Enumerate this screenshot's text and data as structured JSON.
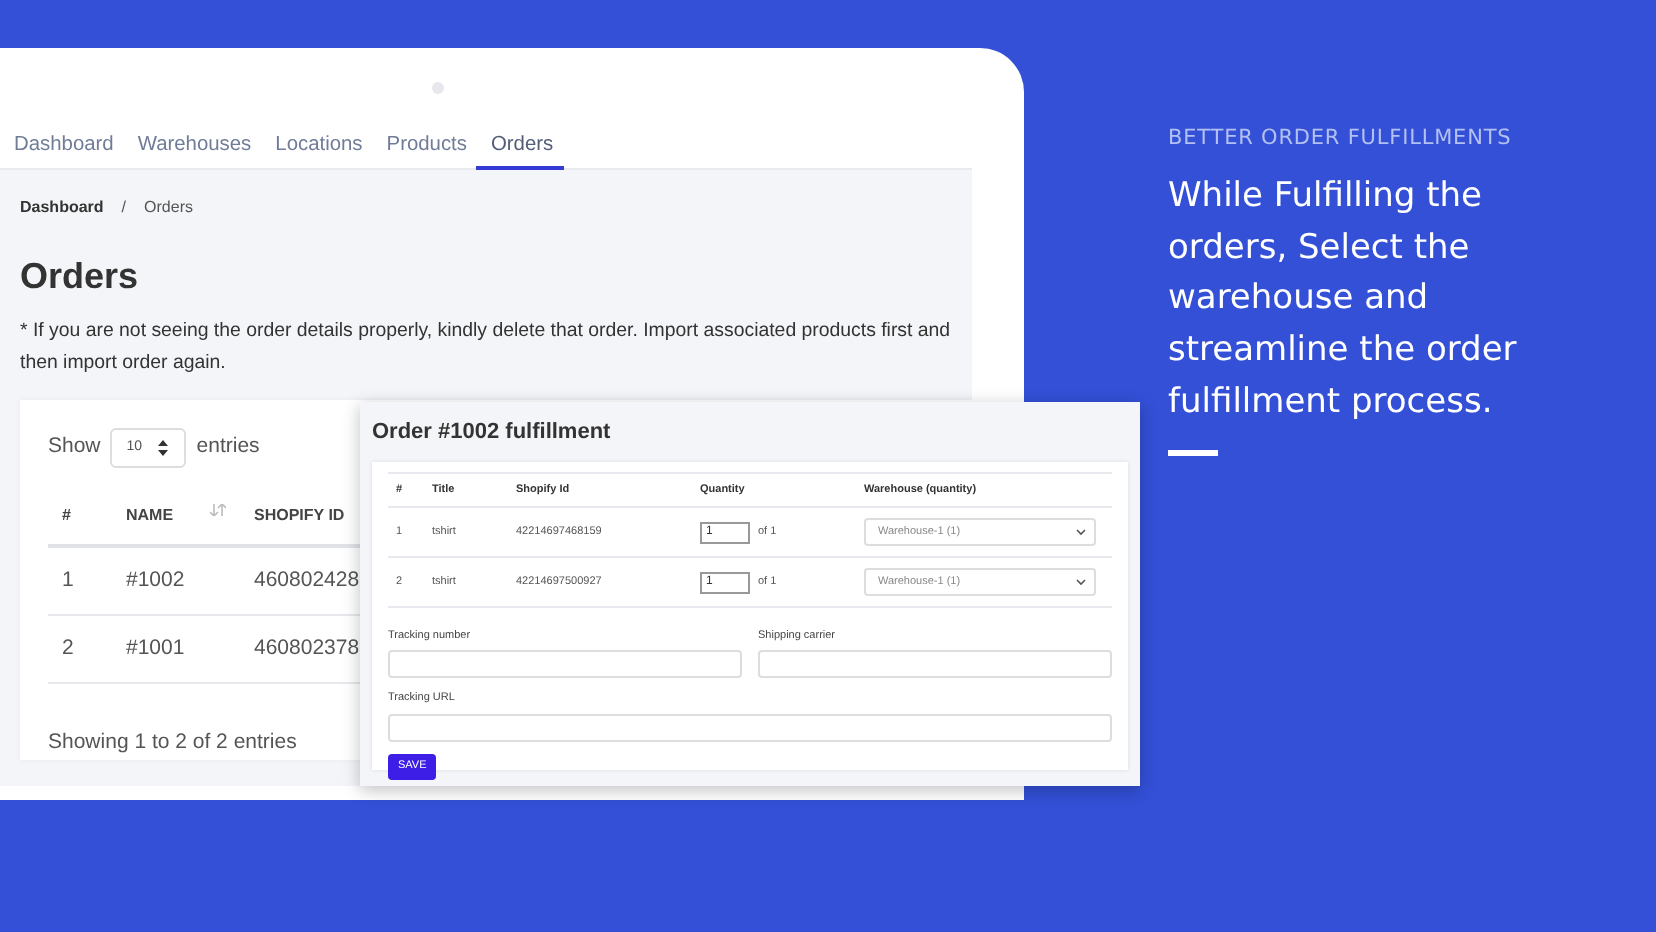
{
  "app": {
    "nav_tabs": [
      {
        "label": "Dashboard",
        "selected": false
      },
      {
        "label": "Warehouses",
        "selected": false
      },
      {
        "label": "Locations",
        "selected": false
      },
      {
        "label": "Products",
        "selected": false
      },
      {
        "label": "Orders",
        "selected": true
      }
    ],
    "breadcrumb": [
      "Dashboard",
      "/",
      "Orders"
    ],
    "title": "Orders",
    "note": "* If you are not seeing the order details properly, kindly delete that order. Import associated products first and then import order again.",
    "length_menu": {
      "label_before": "Show",
      "value": "10",
      "label_after": "entries"
    },
    "table": {
      "columns": [
        "#",
        "NAME",
        "SHOPIFY ID"
      ],
      "rows": [
        [
          "1",
          "#1002",
          "460802428"
        ],
        [
          "2",
          "#1001",
          "460802378"
        ]
      ]
    },
    "info": "Showing 1 to 2 of 2 entries"
  },
  "modal": {
    "title": "Order #1002 fulfillment",
    "columns": [
      "#",
      "Title",
      "Shopify Id",
      "Quantity",
      "Warehouse (quantity)"
    ],
    "rows": [
      {
        "index": "1",
        "title": "tshirt",
        "shopify_id": "42214697468159",
        "quantity": "1",
        "of": "of 1",
        "warehouse": "Warehouse-1 (1)"
      },
      {
        "index": "2",
        "title": "tshirt",
        "shopify_id": "42214697500927",
        "quantity": "1",
        "of": "of 1",
        "warehouse": "Warehouse-1 (1)"
      }
    ],
    "fields": [
      {
        "label": "Tracking number"
      },
      {
        "label": "Shipping carrier"
      },
      {
        "label": "Tracking URL"
      }
    ],
    "save_button": "SAVE"
  },
  "promo": {
    "kicker": "BETTER ORDER FULFILLMENTS",
    "headline": "While Fulfilling the orders, Select the warehouse and streamline the order fulfillment process."
  }
}
